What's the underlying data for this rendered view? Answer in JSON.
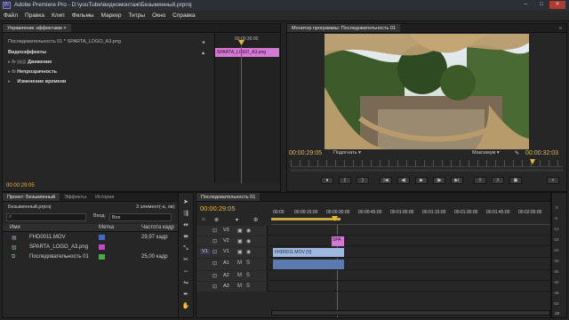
{
  "window": {
    "title": "Adobe Premiere Pro - D:\\youTube\\видеомонтаж\\Безымянный.prproj",
    "logo": "Pr",
    "min": "–",
    "max": "□",
    "close": "✕"
  },
  "menu": [
    "Файл",
    "Правка",
    "Клип",
    "Фильмы",
    "Маркер",
    "Титры",
    "Окно",
    "Справка"
  ],
  "effects_panel": {
    "tab_label": "Управление эффектами",
    "close_icon": "×",
    "header_left": "Последовательность 01 * SPARTA_LOGO_A3.png",
    "ruler_time": "00:00:30:00",
    "clip_name": "SPARTA_LOGO_A3.png",
    "section": "Видеоэффекты",
    "effects": [
      {
        "fx": "fx",
        "label": "Движение"
      },
      {
        "fx": "fx",
        "label": "Непрозрачность"
      },
      {
        "fx": "",
        "label": "Изменение времени"
      }
    ],
    "timecode": "00:00:29:05"
  },
  "program_monitor": {
    "tab_label": "Монитор программы: Последовательность 01",
    "menu_icon": "≡",
    "timecode_left": "00:00:29:05",
    "fit": "Подогнать",
    "quality": "Максимум",
    "timecode_right": "00:00:32:03"
  },
  "project_panel": {
    "tabs": [
      "Проект: Безымянный",
      "Эффекты",
      "История"
    ],
    "file": "Безымянный.prproj",
    "count": "3 элемент(-а, ов)",
    "search_placeholder": "",
    "entry_label": "Вход:",
    "entry_value": "Все",
    "columns": [
      "Имя",
      "Метка",
      "Частота кадр"
    ],
    "items": [
      {
        "name": "FHD0011.MOV",
        "label_color": "#3a6ae0",
        "rate": "29,97 кадр"
      },
      {
        "name": "SPARTA_LOGO_A3.png",
        "label_color": "#d040d0",
        "rate": ""
      },
      {
        "name": "Последовательность 01",
        "label_color": "#40b040",
        "rate": "25,00 кадр"
      }
    ]
  },
  "timeline": {
    "tab_label": "Последовательность 01",
    "timecode": "00:00:29:05",
    "ruler": [
      "00:00",
      "00:00:15:00",
      "00:00:30:00",
      "00:00:45:00",
      "00:01:00:00",
      "00:01:15:00",
      "00:01:30:00",
      "00:01:45:00",
      "00:02:00:00"
    ],
    "tracks": [
      {
        "name": "V3",
        "src": ""
      },
      {
        "name": "V2",
        "src": ""
      },
      {
        "name": "V1",
        "src": "V1"
      },
      {
        "name": "A1",
        "src": ""
      },
      {
        "name": "A2",
        "src": ""
      },
      {
        "name": "A3",
        "src": ""
      }
    ],
    "clip_logo": "SPA",
    "clip_video": "FHD0011.MOV [V]",
    "mute": "M",
    "solo": "S"
  },
  "vu_meter": {
    "scale": [
      "0",
      "-6",
      "-12",
      "-18",
      "-24",
      "-30",
      "-36",
      "-42",
      "-48",
      "-54"
    ],
    "bottom": "dB"
  },
  "icons": {
    "lock": "🔒",
    "eye": "◉",
    "speaker": "◀",
    "wrench": "🔧",
    "plus": "+",
    "camera": "📷"
  }
}
